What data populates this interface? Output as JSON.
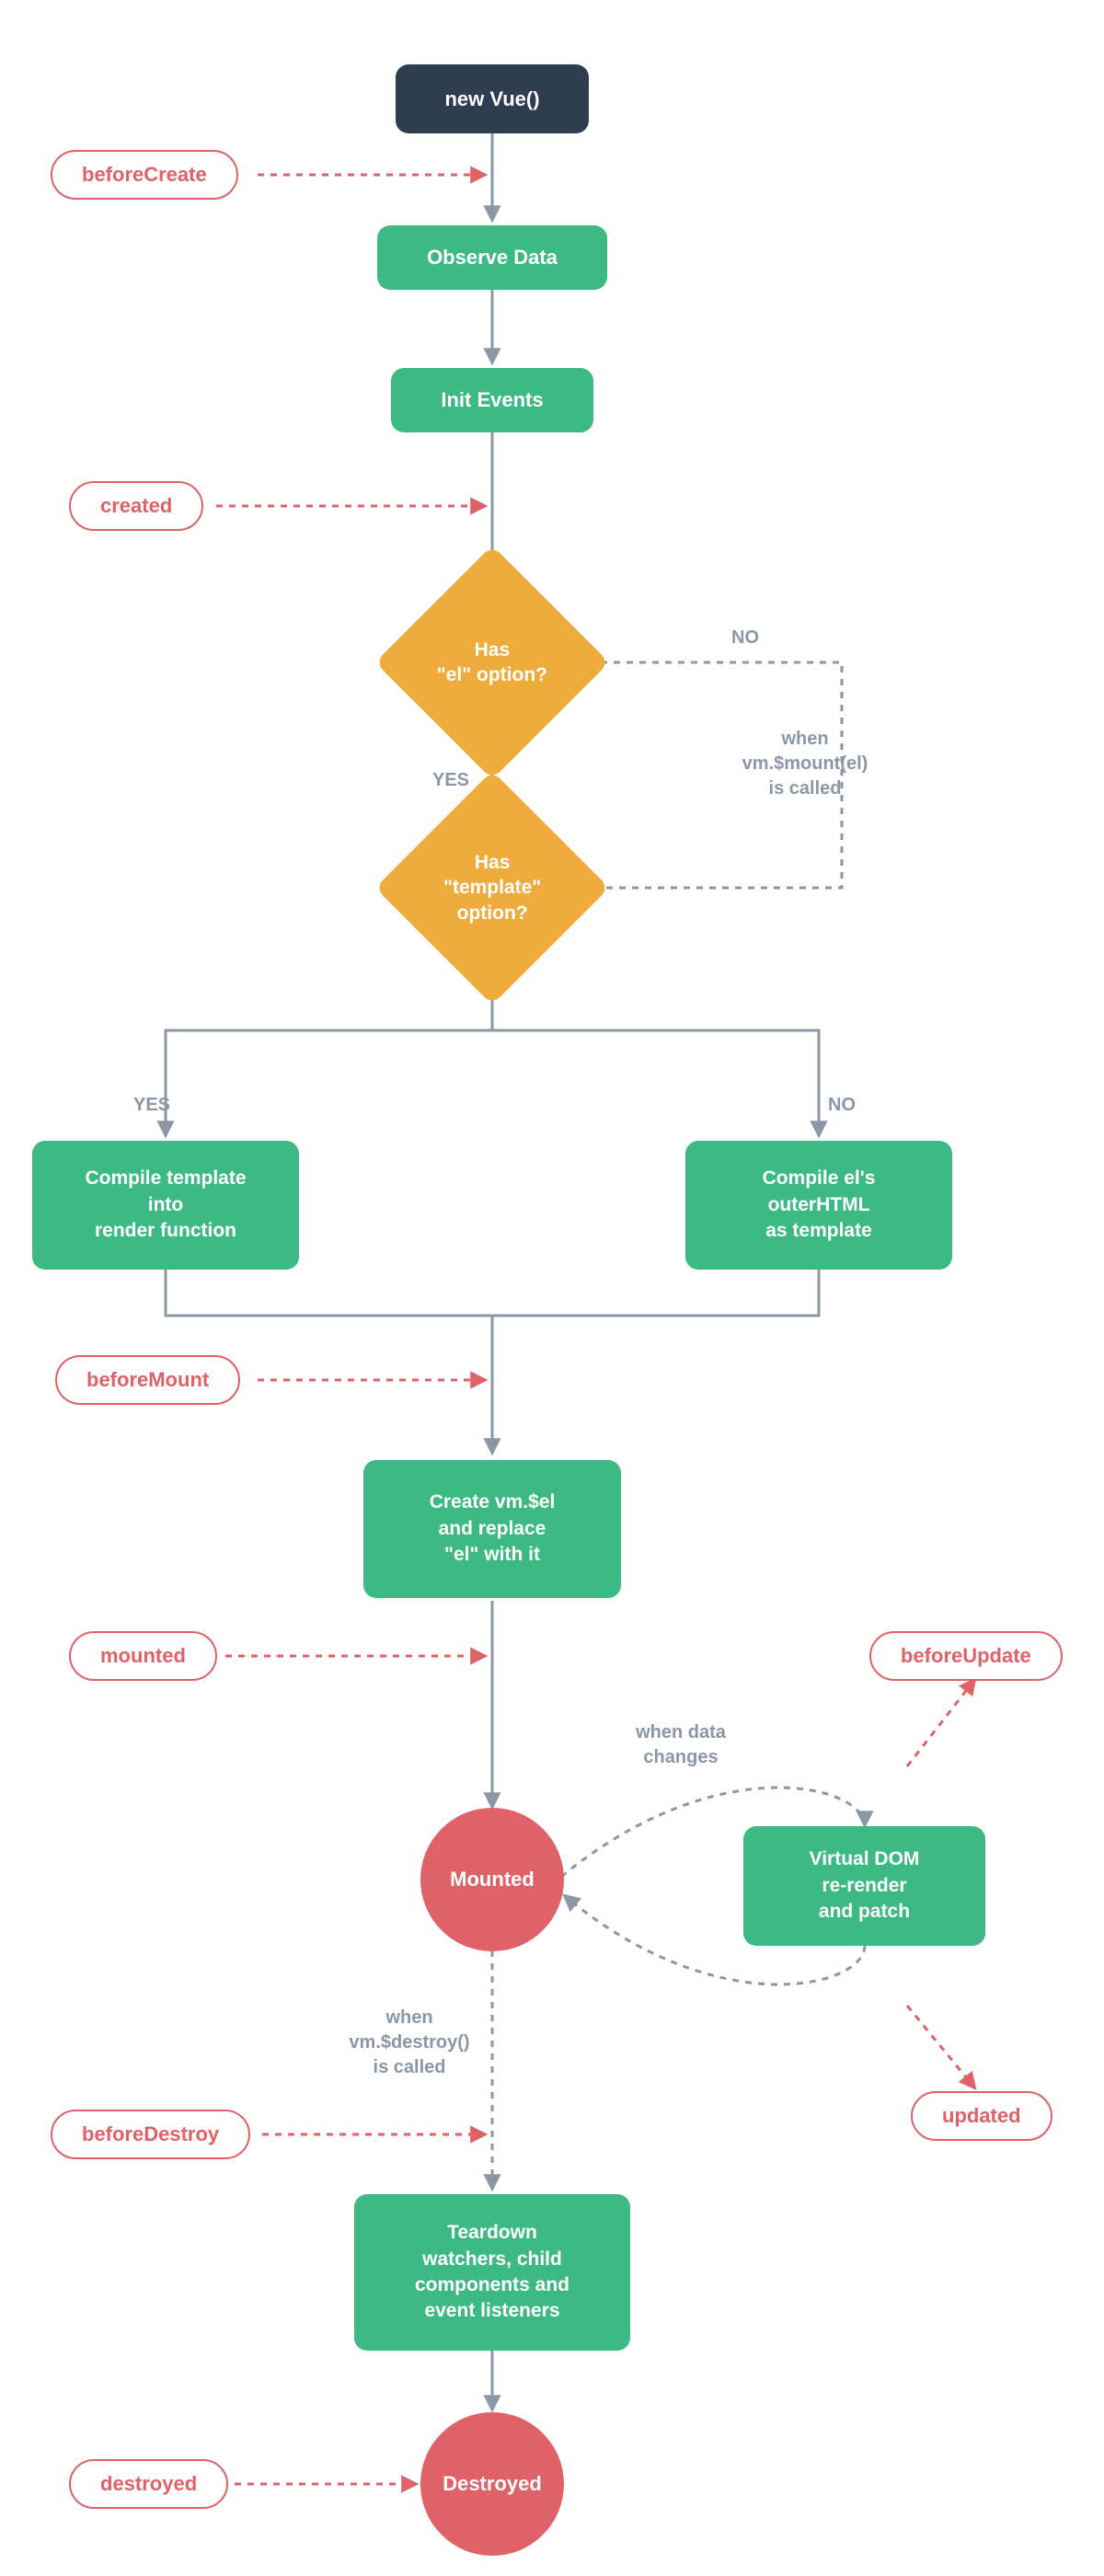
{
  "nodes": {
    "start": "new Vue()",
    "observe": "Observe Data",
    "initEvents": "Init Events",
    "dHasEl": "Has\n\"el\" option?",
    "dHasTemplate": "Has\n\"template\"\noption?",
    "compileTemplate": "Compile template\ninto\nrender function",
    "compileEl": "Compile el's\nouterHTML\nas template",
    "createEl": "Create vm.$el\nand replace\n\"el\" with it",
    "mountedCircle": "Mounted",
    "virtualDom": "Virtual DOM\nre-render\nand patch",
    "teardown": "Teardown\nwatchers, child\ncomponents and\nevent listeners",
    "destroyedCircle": "Destroyed"
  },
  "hooks": {
    "beforeCreate": "beforeCreate",
    "created": "created",
    "beforeMount": "beforeMount",
    "mounted": "mounted",
    "beforeUpdate": "beforeUpdate",
    "updated": "updated",
    "beforeDestroy": "beforeDestroy",
    "destroyed": "destroyed"
  },
  "labels": {
    "yes1": "YES",
    "no1": "NO",
    "yes2": "YES",
    "no2": "NO",
    "whenMount": "when\nvm.$mount(el)\nis called",
    "whenData": "when data\nchanges",
    "whenDestroy": "when\nvm.$destroy()\nis called"
  }
}
